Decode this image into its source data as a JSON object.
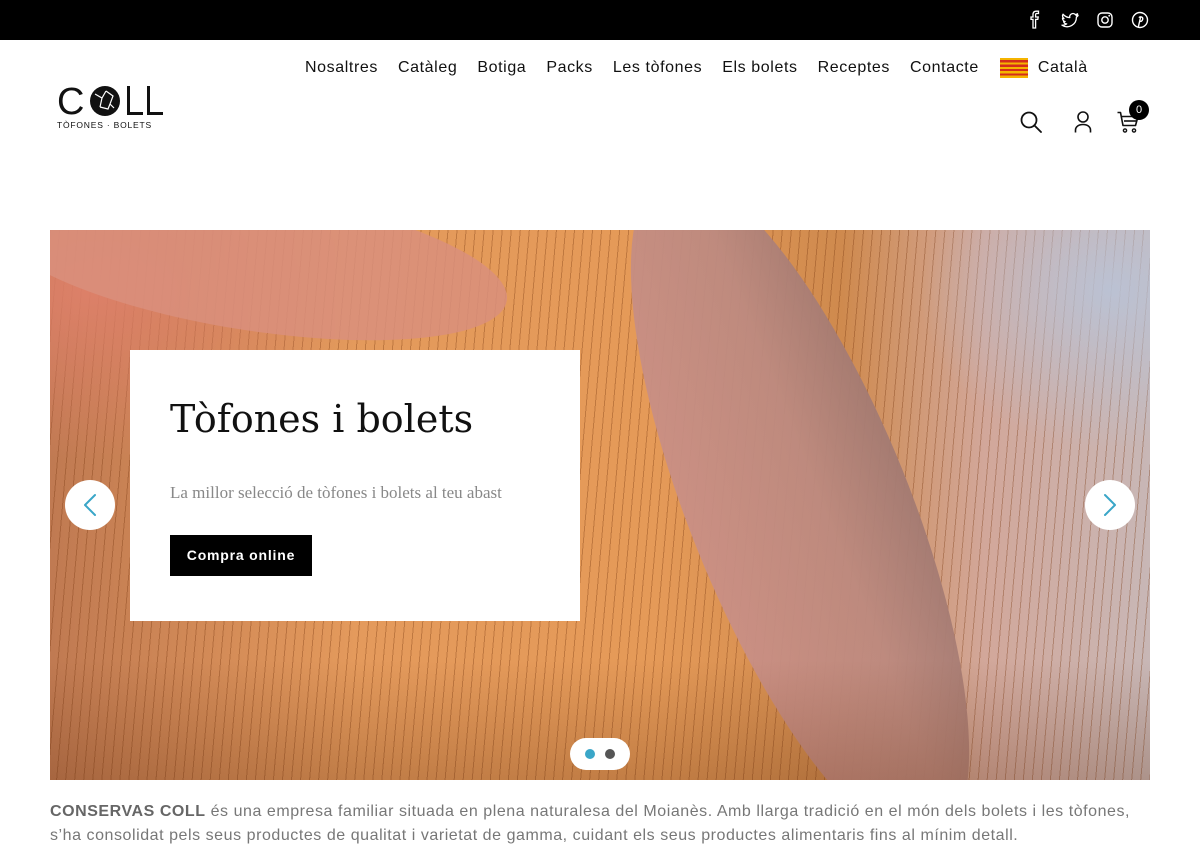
{
  "topbar": {
    "social": [
      {
        "icon": "facebook-icon"
      },
      {
        "icon": "twitter-icon"
      },
      {
        "icon": "instagram-icon"
      },
      {
        "icon": "pinterest-icon"
      }
    ]
  },
  "brand": {
    "logo_text": "COLL",
    "logo_sub": "TÒFONES · BOLETS"
  },
  "nav": {
    "items": [
      "Nosaltres",
      "Catàleg",
      "Botiga",
      "Packs",
      "Les tòfones",
      "Els bolets",
      "Receptes",
      "Contacte"
    ],
    "language": "Català"
  },
  "tools": {
    "cart_count": "0"
  },
  "hero": {
    "title": "Tòfones i bolets",
    "subtitle": "La millor selecció de tòfones i bolets al teu abast",
    "cta": "Compra online",
    "slides_total": 2,
    "active_slide": 1
  },
  "intro": {
    "company": "CONSERVAS COLL",
    "text": " és una empresa familiar situada en plena naturalesa del Moianès. Amb llarga tradició en el món dels bolets i les tòfones, s’ha consolidat pels seus productes de qualitat i varietat de gamma, cuidant els seus productes alimentaris fins al mínim detall."
  },
  "colors": {
    "accent": "#3aa6c8",
    "topbar": "#000000",
    "button": "#000000"
  }
}
